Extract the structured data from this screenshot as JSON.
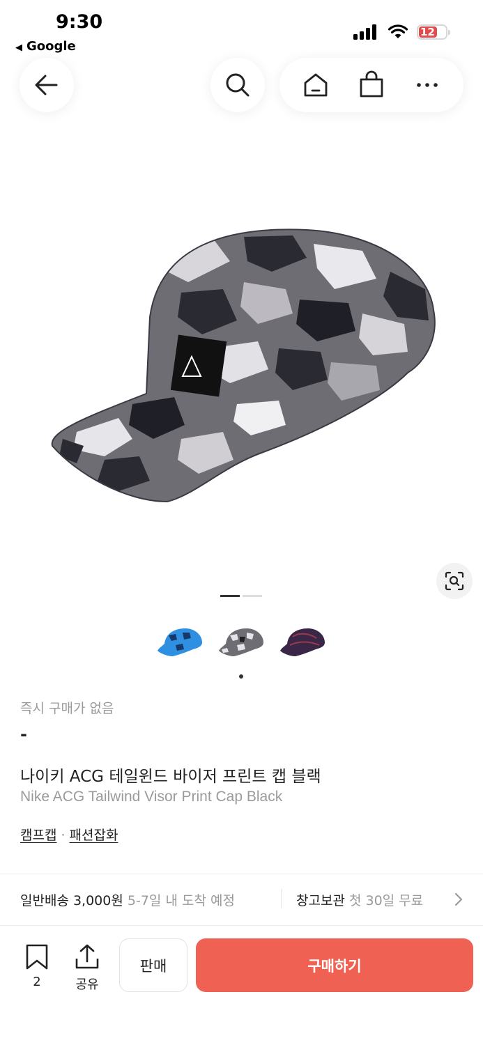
{
  "status_bar": {
    "time": "9:30",
    "back_app": "Google",
    "battery": "12"
  },
  "nav": {
    "back_icon": "arrow-left-icon",
    "search_icon": "search-icon",
    "home_icon": "home-icon",
    "bag_icon": "shopping-bag-icon",
    "more_icon": "more-dots-icon"
  },
  "gallery": {
    "image_count": 2,
    "current_index": 1,
    "lens_icon": "image-search-icon"
  },
  "colors": {
    "thumbs": [
      "blue camo",
      "grey camo",
      "purple"
    ],
    "selected_index": 1,
    "accent": "#ef6253"
  },
  "product": {
    "instant_label": "즉시 구매가 없음",
    "price": "-",
    "name_ko": "나이키 ACG 테일윈드 바이저 프린트 캡 블랙",
    "name_en": "Nike ACG Tailwind Visor Print Cap Black",
    "category_1": "캠프캡",
    "category_sep": "·",
    "category_2": "패션잡화"
  },
  "shipping": {
    "label": "일반배송 3,000원",
    "eta": "5-7일 내 도착 예정",
    "storage_label": "창고보관",
    "storage_detail": "첫 30일 무료"
  },
  "bottom_bar": {
    "bookmark_count": "2",
    "share_label": "공유",
    "sell_label": "판매",
    "buy_label": "구매하기"
  }
}
